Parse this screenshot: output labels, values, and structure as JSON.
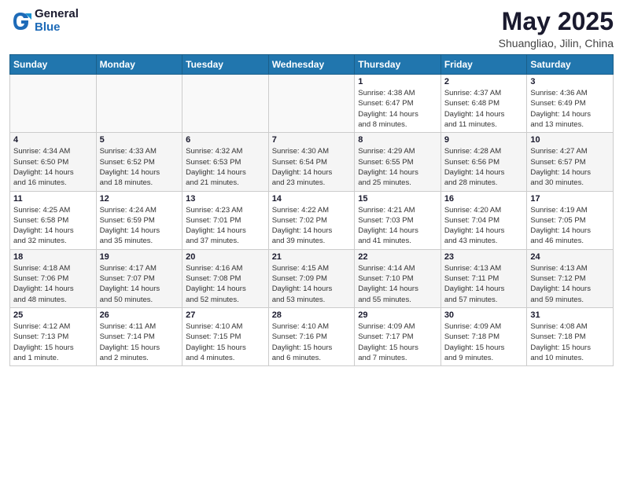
{
  "header": {
    "logo_general": "General",
    "logo_blue": "Blue",
    "month_title": "May 2025",
    "location": "Shuangliao, Jilin, China"
  },
  "calendar": {
    "days_of_week": [
      "Sunday",
      "Monday",
      "Tuesday",
      "Wednesday",
      "Thursday",
      "Friday",
      "Saturday"
    ],
    "weeks": [
      [
        {
          "day": "",
          "info": ""
        },
        {
          "day": "",
          "info": ""
        },
        {
          "day": "",
          "info": ""
        },
        {
          "day": "",
          "info": ""
        },
        {
          "day": "1",
          "info": "Sunrise: 4:38 AM\nSunset: 6:47 PM\nDaylight: 14 hours\nand 8 minutes."
        },
        {
          "day": "2",
          "info": "Sunrise: 4:37 AM\nSunset: 6:48 PM\nDaylight: 14 hours\nand 11 minutes."
        },
        {
          "day": "3",
          "info": "Sunrise: 4:36 AM\nSunset: 6:49 PM\nDaylight: 14 hours\nand 13 minutes."
        }
      ],
      [
        {
          "day": "4",
          "info": "Sunrise: 4:34 AM\nSunset: 6:50 PM\nDaylight: 14 hours\nand 16 minutes."
        },
        {
          "day": "5",
          "info": "Sunrise: 4:33 AM\nSunset: 6:52 PM\nDaylight: 14 hours\nand 18 minutes."
        },
        {
          "day": "6",
          "info": "Sunrise: 4:32 AM\nSunset: 6:53 PM\nDaylight: 14 hours\nand 21 minutes."
        },
        {
          "day": "7",
          "info": "Sunrise: 4:30 AM\nSunset: 6:54 PM\nDaylight: 14 hours\nand 23 minutes."
        },
        {
          "day": "8",
          "info": "Sunrise: 4:29 AM\nSunset: 6:55 PM\nDaylight: 14 hours\nand 25 minutes."
        },
        {
          "day": "9",
          "info": "Sunrise: 4:28 AM\nSunset: 6:56 PM\nDaylight: 14 hours\nand 28 minutes."
        },
        {
          "day": "10",
          "info": "Sunrise: 4:27 AM\nSunset: 6:57 PM\nDaylight: 14 hours\nand 30 minutes."
        }
      ],
      [
        {
          "day": "11",
          "info": "Sunrise: 4:25 AM\nSunset: 6:58 PM\nDaylight: 14 hours\nand 32 minutes."
        },
        {
          "day": "12",
          "info": "Sunrise: 4:24 AM\nSunset: 6:59 PM\nDaylight: 14 hours\nand 35 minutes."
        },
        {
          "day": "13",
          "info": "Sunrise: 4:23 AM\nSunset: 7:01 PM\nDaylight: 14 hours\nand 37 minutes."
        },
        {
          "day": "14",
          "info": "Sunrise: 4:22 AM\nSunset: 7:02 PM\nDaylight: 14 hours\nand 39 minutes."
        },
        {
          "day": "15",
          "info": "Sunrise: 4:21 AM\nSunset: 7:03 PM\nDaylight: 14 hours\nand 41 minutes."
        },
        {
          "day": "16",
          "info": "Sunrise: 4:20 AM\nSunset: 7:04 PM\nDaylight: 14 hours\nand 43 minutes."
        },
        {
          "day": "17",
          "info": "Sunrise: 4:19 AM\nSunset: 7:05 PM\nDaylight: 14 hours\nand 46 minutes."
        }
      ],
      [
        {
          "day": "18",
          "info": "Sunrise: 4:18 AM\nSunset: 7:06 PM\nDaylight: 14 hours\nand 48 minutes."
        },
        {
          "day": "19",
          "info": "Sunrise: 4:17 AM\nSunset: 7:07 PM\nDaylight: 14 hours\nand 50 minutes."
        },
        {
          "day": "20",
          "info": "Sunrise: 4:16 AM\nSunset: 7:08 PM\nDaylight: 14 hours\nand 52 minutes."
        },
        {
          "day": "21",
          "info": "Sunrise: 4:15 AM\nSunset: 7:09 PM\nDaylight: 14 hours\nand 53 minutes."
        },
        {
          "day": "22",
          "info": "Sunrise: 4:14 AM\nSunset: 7:10 PM\nDaylight: 14 hours\nand 55 minutes."
        },
        {
          "day": "23",
          "info": "Sunrise: 4:13 AM\nSunset: 7:11 PM\nDaylight: 14 hours\nand 57 minutes."
        },
        {
          "day": "24",
          "info": "Sunrise: 4:13 AM\nSunset: 7:12 PM\nDaylight: 14 hours\nand 59 minutes."
        }
      ],
      [
        {
          "day": "25",
          "info": "Sunrise: 4:12 AM\nSunset: 7:13 PM\nDaylight: 15 hours\nand 1 minute."
        },
        {
          "day": "26",
          "info": "Sunrise: 4:11 AM\nSunset: 7:14 PM\nDaylight: 15 hours\nand 2 minutes."
        },
        {
          "day": "27",
          "info": "Sunrise: 4:10 AM\nSunset: 7:15 PM\nDaylight: 15 hours\nand 4 minutes."
        },
        {
          "day": "28",
          "info": "Sunrise: 4:10 AM\nSunset: 7:16 PM\nDaylight: 15 hours\nand 6 minutes."
        },
        {
          "day": "29",
          "info": "Sunrise: 4:09 AM\nSunset: 7:17 PM\nDaylight: 15 hours\nand 7 minutes."
        },
        {
          "day": "30",
          "info": "Sunrise: 4:09 AM\nSunset: 7:18 PM\nDaylight: 15 hours\nand 9 minutes."
        },
        {
          "day": "31",
          "info": "Sunrise: 4:08 AM\nSunset: 7:18 PM\nDaylight: 15 hours\nand 10 minutes."
        }
      ]
    ]
  }
}
